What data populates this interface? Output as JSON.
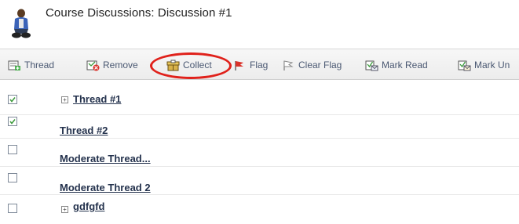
{
  "header": {
    "title": "Course Discussions: Discussion #1",
    "avatar_icon": "person-avatar-icon"
  },
  "toolbar": {
    "buttons": [
      {
        "label": "Thread",
        "icon": "new-thread-icon"
      },
      {
        "label": "Remove",
        "icon": "remove-icon"
      },
      {
        "label": "Collect",
        "icon": "collect-icon",
        "highlighted": true
      },
      {
        "label": "Flag",
        "icon": "flag-icon"
      },
      {
        "label": "Clear Flag",
        "icon": "clear-flag-icon"
      },
      {
        "label": "Mark Read",
        "icon": "mark-read-icon"
      },
      {
        "label": "Mark Un",
        "icon": "mark-unread-icon"
      }
    ],
    "highlight_color": "#e0211b"
  },
  "threads": [
    {
      "title": "Thread #1",
      "checked": true,
      "expandable": true
    },
    {
      "title": "Thread #2",
      "checked": true,
      "expandable": false
    },
    {
      "title": "Moderate Thread...",
      "checked": false,
      "expandable": false
    },
    {
      "title": "Moderate Thread 2",
      "checked": false,
      "expandable": false
    },
    {
      "title": "gdfgfd",
      "checked": false,
      "expandable": true
    }
  ],
  "colors": {
    "link": "#24324d",
    "toolbar_text": "#4a5872",
    "check": "#3a9a3a"
  }
}
